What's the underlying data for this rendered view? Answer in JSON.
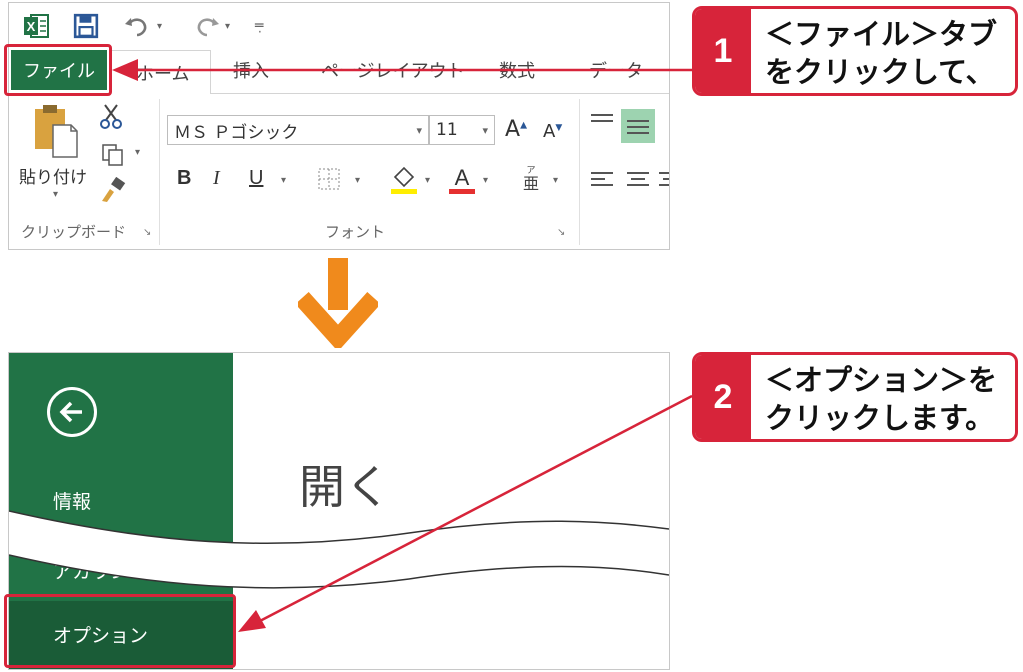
{
  "colors": {
    "excel_green": "#217346",
    "excel_green_dark": "#1a5c37",
    "callout_red": "#d7243a",
    "arrow_orange": "#f08a1c"
  },
  "ribbon": {
    "tabs": {
      "file": "ファイル",
      "home": "ホーム",
      "insert": "挿入",
      "page_layout": "ページレイアウト",
      "formulas": "数式",
      "data": "データ"
    },
    "clipboard": {
      "paste_label": "貼り付け",
      "group_label": "クリップボード"
    },
    "font": {
      "font_name": "ＭＳ Ｐゴシック",
      "font_size": "11",
      "bold": "B",
      "italic": "I",
      "underline": "U",
      "group_label": "フォント"
    }
  },
  "backstage": {
    "items": {
      "info": "情報",
      "account": "アカウント",
      "options": "オプション"
    },
    "title": "開く"
  },
  "callouts": [
    {
      "number": "1",
      "line1": "＜ファイル＞タブ",
      "line2": "をクリックして、"
    },
    {
      "number": "2",
      "line1": "＜オプション＞を",
      "line2": "クリックします。"
    }
  ]
}
